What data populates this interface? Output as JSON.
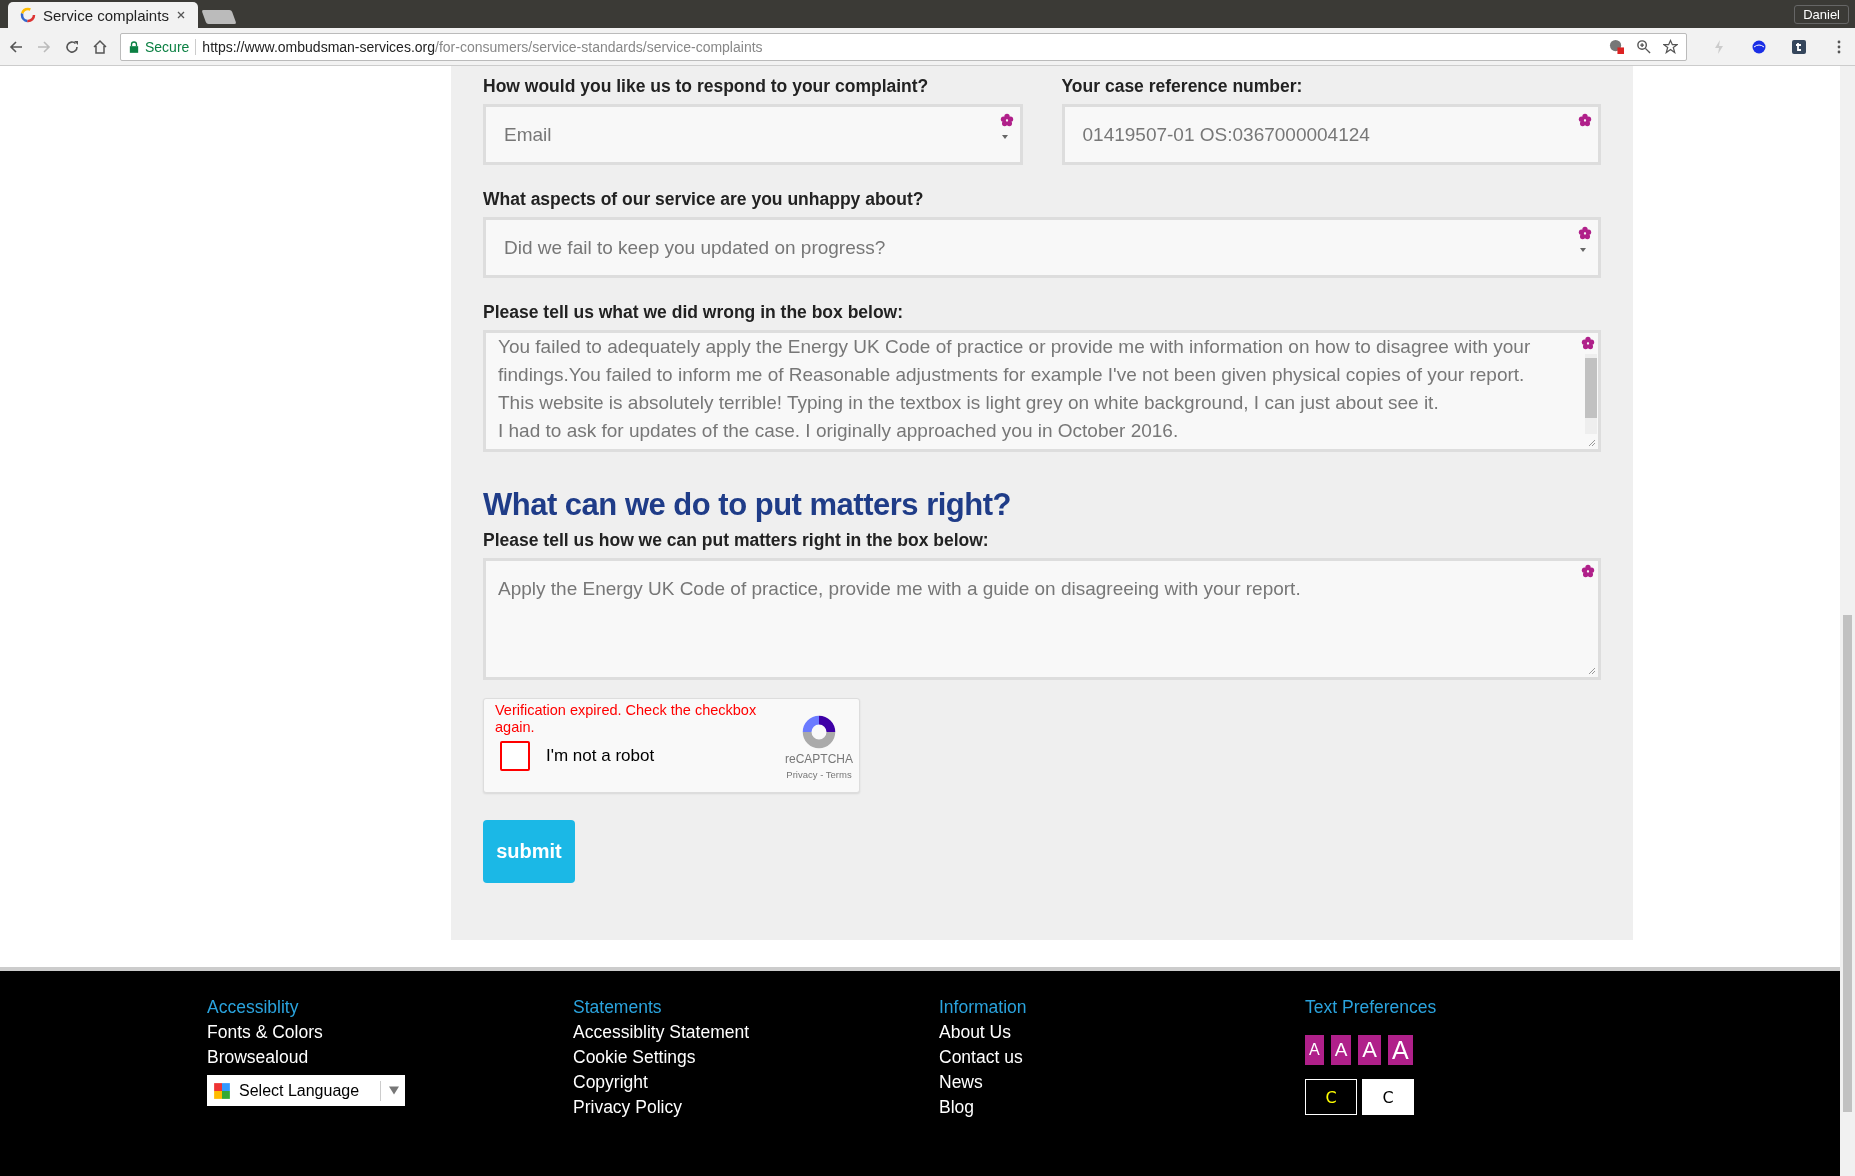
{
  "browser": {
    "tabs": [
      {
        "title": "Service complaints",
        "selected": true
      },
      {
        "selected": false
      }
    ],
    "profile": "Daniel",
    "secure_label": "Secure",
    "url_host": "https://www.ombudsman-services.org",
    "url_path": "/for-consumers/service-standards/service-complaints"
  },
  "form": {
    "fields": [
      {
        "kind": "select",
        "label": "How would you like us to respond to your complaint?",
        "value": "Email"
      },
      {
        "kind": "input",
        "label": "Your case reference number:",
        "value": "01419507-01 OS:0367000004124"
      },
      {
        "kind": "select",
        "label": "What aspects of our service are you unhappy about?",
        "value": "Did we fail to keep you updated on progress?"
      },
      {
        "kind": "textarea",
        "label": "Please tell us what we did wrong in the box below:",
        "value": "You failed to adequately apply the Energy UK Code of practice or provide me with information on how to disagree with your findings.You failed to inform me of Reasonable adjustments for example I've not been given physical copies of your report.\nThis website is absolutely terrible! Typing in the textbox is light grey on white background, I can just about see it.\nI had to ask for updates of the case. I originally approached you in October 2016.",
        "scrollbar": true
      },
      {
        "kind": "heading",
        "label": "What can we do to put matters right?"
      },
      {
        "kind": "textarea",
        "label": "Please tell us how we can put matters right in the box below:",
        "value": "Apply the Energy UK Code of practice, provide me with a guide on disagreeing with your report.",
        "scrollbar": false
      }
    ],
    "recaptcha": {
      "error": "Verification expired. Check the checkbox again.",
      "label": "I'm not a robot",
      "checked": false,
      "brand": "reCAPTCHA",
      "privacy": "Privacy",
      "separator": " - ",
      "terms": "Terms"
    },
    "submit": "submit"
  },
  "footer": {
    "columns": [
      {
        "heading": "Accessiblity",
        "links": [
          "Fonts & Colors",
          "Browsealoud"
        ],
        "language": "Select Language"
      },
      {
        "heading": "Statements",
        "links": [
          "Accessiblity Statement",
          "Cookie Settings",
          "Copyright",
          "Privacy Policy"
        ]
      },
      {
        "heading": "Information",
        "links": [
          "About Us",
          "Contact us",
          "News",
          "Blog"
        ]
      }
    ],
    "text_preferences": {
      "heading": "Text Preferences",
      "sizes": [
        "A",
        "A",
        "A",
        "A"
      ],
      "contrast": [
        {
          "label": "C",
          "kind": "dark"
        },
        {
          "label": "C",
          "kind": "light"
        }
      ]
    }
  }
}
